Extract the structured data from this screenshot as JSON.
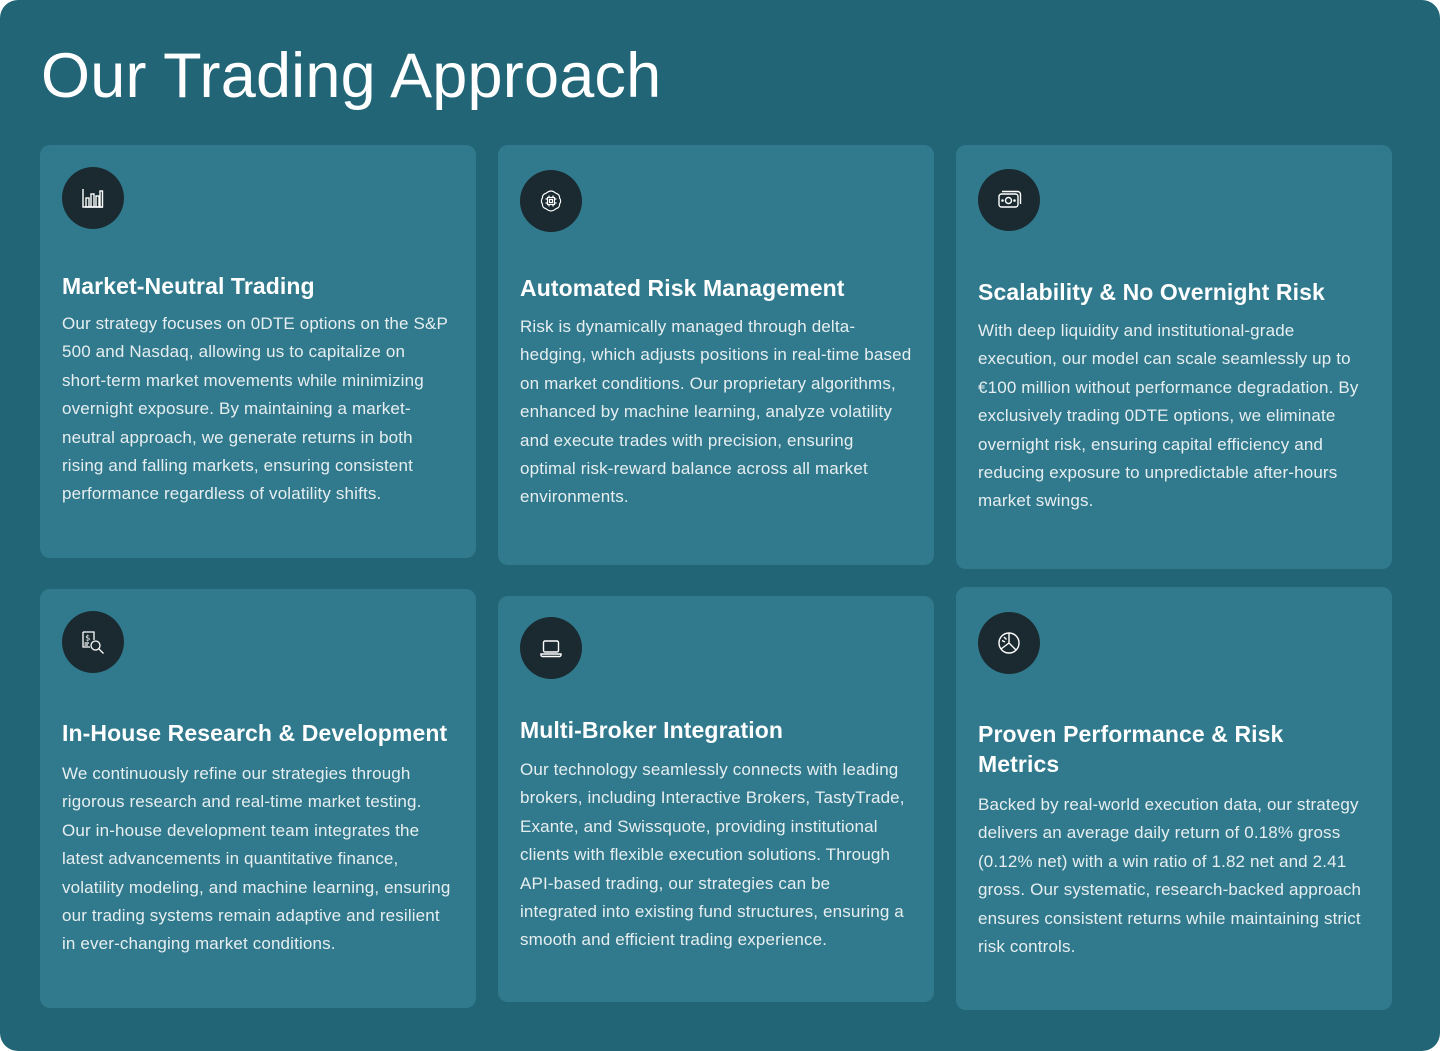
{
  "section": {
    "title": "Our Trading Approach"
  },
  "cards": [
    {
      "icon": "bar-chart-icon",
      "title": "Market-Neutral Trading",
      "text": "Our strategy focuses on 0DTE options on the S&P 500 and Nasdaq, allowing us to capitalize on short-term market movements while minimizing overnight exposure. By maintaining a market-neutral approach, we generate returns in both rising and falling markets, ensuring consistent performance regardless of volatility shifts."
    },
    {
      "icon": "cpu-chip-icon",
      "title": "Automated Risk Management",
      "text": "Risk is dynamically managed through delta-hedging, which adjusts positions in real-time based on market conditions. Our proprietary algorithms, enhanced by machine learning, analyze volatility and execute trades with precision, ensuring optimal risk-reward balance across all market environments."
    },
    {
      "icon": "banknote-icon",
      "title": "Scalability & No Overnight Risk",
      "text": "With deep liquidity and institutional-grade execution, our model can scale seamlessly up to €100 million without performance degradation. By exclusively trading 0DTE options, we eliminate overnight risk, ensuring capital efficiency and reducing exposure to unpredictable after-hours market swings."
    },
    {
      "icon": "research-magnifier-icon",
      "title": "In-House Research & Development",
      "text": "We continuously refine our strategies through rigorous research and real-time market testing. Our in-house development team integrates the latest advancements in quantitative finance, volatility modeling, and machine learning, ensuring our trading systems remain adaptive and resilient in ever-changing market conditions."
    },
    {
      "icon": "laptop-icon",
      "title": "Multi-Broker Integration",
      "text": "Our technology seamlessly connects with leading brokers, including Interactive Brokers, TastyTrade, Exante, and Swissquote, providing institutional clients with flexible execution solutions. Through API-based trading, our strategies can be integrated into existing fund structures, ensuring a smooth and efficient trading experience."
    },
    {
      "icon": "pie-chart-icon",
      "title": "Proven Performance & Risk Metrics",
      "text": "Backed by real-world execution data, our strategy delivers an average daily return of 0.18% gross (0.12% net) with a win ratio of 1.82 net and 2.41 gross. Our systematic, research-backed approach ensures consistent returns while maintaining strict risk controls."
    }
  ]
}
